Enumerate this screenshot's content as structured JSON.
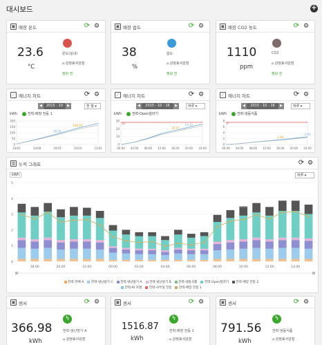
{
  "app": {
    "title": "대시보드"
  },
  "sensors": [
    {
      "title": "매장 온도",
      "value": "23.6",
      "unit": "°C",
      "name": "온도(실내)",
      "location": "강정효서강점",
      "status": "정보 전",
      "icon": "thermometer-icon",
      "color": "#d9534f"
    },
    {
      "title": "매장 습도",
      "value": "38",
      "unit": "%",
      "name": "습도",
      "location": "강정효서강점",
      "status": "정보 전",
      "icon": "water-drop-icon",
      "color": "#3b9bd8"
    },
    {
      "title": "매장 CO2 농도",
      "value": "1110",
      "unit": "ppm",
      "name": "CO2",
      "location": "강정효서강점",
      "status": "정보 전",
      "icon": "gauge-icon",
      "color": "#7d6a6a"
    }
  ],
  "energy_charts": [
    {
      "title": "에너지 차트",
      "date": "2015 - 10",
      "mode": "전 월",
      "unit": "kWh",
      "legend": "전력-매장 전등 1",
      "chart_data": {
        "type": "line",
        "x": [
          "10/01",
          "10/08",
          "10/16",
          "10/24",
          "11/01"
        ],
        "ylim": [
          0,
          200
        ],
        "yticks": [
          0,
          50,
          100,
          150,
          200
        ],
        "series": [
          {
            "name": "전력-매장 전등 1",
            "values": [
              5,
              45,
              90,
              140,
              180
            ]
          }
        ],
        "annotations": [
          {
            "label": "95.16",
            "x": "10/16"
          },
          {
            "label": "180.76",
            "x": "10/24"
          }
        ]
      }
    },
    {
      "title": "에너지 차트",
      "date": "2015 - 10 - 16",
      "mode": "하루",
      "unit": "kWh",
      "legend": "전력-Open칠러기",
      "chart_data": {
        "type": "line",
        "x": [
          "00:00",
          "04:00",
          "08:00",
          "12:00",
          "16:00",
          "20:00",
          "24:00"
        ],
        "ylim": [
          0,
          30
        ],
        "yticks": [
          0,
          10,
          20,
          30
        ],
        "series": [
          {
            "name": "전력-Open칠러기",
            "values": [
              0,
              3,
              8,
              14,
              18,
              22,
              26
            ]
          }
        ],
        "annotations": [
          {
            "label": "30",
            "x": "00:00"
          },
          {
            "label": "18.72",
            "x": "16:00"
          },
          {
            "label": "15.35",
            "x": "20:00"
          }
        ]
      }
    },
    {
      "title": "에너지 차트",
      "date": "2015 - 10 - 16",
      "mode": "하루",
      "unit": "kWh",
      "legend": "전력-냉동식품",
      "chart_data": {
        "type": "line",
        "x": [
          "00:00",
          "04:00",
          "08:00",
          "12:00",
          "16:00",
          "20:00",
          "24:00"
        ],
        "ylim": [
          0,
          8
        ],
        "yticks": [
          0,
          2,
          4,
          6,
          8
        ],
        "series": [
          {
            "name": "전력-냉동식품",
            "values": [
              0,
              0.3,
              0.8,
              1.2,
              1.6,
              2.1,
              2.6
            ]
          }
        ],
        "annotations": [
          {
            "label": "6",
            "x": "00:00"
          },
          {
            "label": "1.99",
            "x": "16:00"
          },
          {
            "label": "3.93",
            "x": "24:00"
          }
        ]
      }
    }
  ],
  "stack": {
    "title": "누적 그래프",
    "unit": "kWh",
    "mode": "하루",
    "chart_data": {
      "type": "bar",
      "ylim": [
        0,
        5
      ],
      "yticks": [
        0,
        1,
        2,
        3,
        4,
        5
      ],
      "xticks": [
        "18:00",
        "20:00",
        "22:00",
        "00:00",
        "02:00",
        "04:00",
        "06:00",
        "08:00",
        "10:00",
        "12:00",
        "14:00"
      ],
      "categories": [
        "17:00",
        "18:00",
        "19:00",
        "20:00",
        "21:00",
        "22:00",
        "23:00",
        "00:00",
        "01:00",
        "02:00",
        "03:00",
        "04:00",
        "05:00",
        "06:00",
        "07:00",
        "08:00",
        "09:00",
        "10:00",
        "11:00",
        "12:00",
        "13:00",
        "14:00",
        "15:00"
      ],
      "totals": [
        3.65,
        3.45,
        3.7,
        3.3,
        3.45,
        3.4,
        3.2,
        2.3,
        2.0,
        1.85,
        1.85,
        1.6,
        2.0,
        1.75,
        1.85,
        2.95,
        3.25,
        3.5,
        3.7,
        3.45,
        3.85,
        3.85,
        3.6
      ],
      "line": [
        2.95,
        2.7,
        3.1,
        2.5,
        2.6,
        2.65,
        2.3,
        1.55,
        1.3,
        1.2,
        1.25,
        0.95,
        1.15,
        1.05,
        1.2,
        2.2,
        2.55,
        2.65,
        2.95,
        2.7,
        3.1,
        3.15,
        2.85
      ],
      "series": [
        {
          "name": "전력-전체 A",
          "color": "#f3c18d",
          "values": [
            0.15,
            0.15,
            0.15,
            0.15,
            0.15,
            0.15,
            0.15,
            0.1,
            0.1,
            0.1,
            0.1,
            0.1,
            0.1,
            0.1,
            0.1,
            0.15,
            0.15,
            0.15,
            0.15,
            0.15,
            0.15,
            0.15,
            0.15
          ]
        },
        {
          "name": "전력-냉난방기 C",
          "color": "#9ccbec",
          "values": [
            0.7,
            0.65,
            0.7,
            0.6,
            0.65,
            0.65,
            0.6,
            0.45,
            0.4,
            0.35,
            0.35,
            0.3,
            0.4,
            0.35,
            0.35,
            0.55,
            0.6,
            0.65,
            0.7,
            0.65,
            0.7,
            0.7,
            0.65
          ]
        },
        {
          "name": "전력-냉난방기 A",
          "color": "#8e8fd0",
          "values": [
            0.5,
            0.45,
            0.5,
            0.45,
            0.45,
            0.45,
            0.45,
            0.3,
            0.25,
            0.25,
            0.25,
            0.2,
            0.25,
            0.25,
            0.25,
            0.4,
            0.45,
            0.45,
            0.5,
            0.45,
            0.5,
            0.5,
            0.5
          ]
        },
        {
          "name": "전력-냉난방기 B",
          "color": "#e7b3d6",
          "values": [
            0.15,
            0.15,
            0.15,
            0.15,
            0.15,
            0.15,
            0.15,
            0.1,
            0.1,
            0.1,
            0.1,
            0.1,
            0.1,
            0.1,
            0.1,
            0.15,
            0.15,
            0.15,
            0.15,
            0.15,
            0.15,
            0.15,
            0.15
          ]
        },
        {
          "name": "전력-Open칠러기",
          "color": "#6fcfc4",
          "values": [
            1.6,
            1.5,
            1.65,
            1.45,
            1.5,
            1.5,
            1.4,
            1.0,
            0.85,
            0.8,
            0.8,
            0.65,
            0.85,
            0.7,
            0.8,
            1.25,
            1.4,
            1.5,
            1.6,
            1.5,
            1.7,
            1.7,
            1.55
          ]
        },
        {
          "name": "전력-매장 전등 2",
          "color": "#555555",
          "values": [
            0.55,
            0.55,
            0.55,
            0.5,
            0.55,
            0.5,
            0.45,
            0.35,
            0.3,
            0.25,
            0.25,
            0.25,
            0.3,
            0.25,
            0.25,
            0.45,
            0.5,
            0.55,
            0.6,
            0.55,
            0.65,
            0.65,
            0.6
          ]
        }
      ]
    },
    "legend": [
      "전력-전체 A",
      "전력-냉난방기 C",
      "전력-냉난방기 A",
      "전력-냉난방기 B",
      "전력-냉동식품",
      "전력-Open칠러기",
      "전력-매장 전등 2",
      "전력-RI 조명",
      "전력-사무실 전등",
      "전력-매장 전등 1"
    ],
    "legend_colors": [
      "#f0a860",
      "#9ccbec",
      "#8e8fd0",
      "#e7b3d6",
      "#7fbf7f",
      "#6fcfc4",
      "#555555",
      "#86c3e9",
      "#d96b6b",
      "#c9a96b"
    ]
  },
  "bottom": [
    {
      "title": "센서",
      "value": "366.98",
      "unit": "kWh",
      "name": "전력-냉난방기 A",
      "location": "강정효서강점"
    },
    {
      "title": "센서",
      "value": "1516.87",
      "unit": "kWh",
      "name": "전력-매장 전등 1",
      "location": "강정효서강점"
    },
    {
      "title": "센서",
      "value": "791.56",
      "unit": "kWh",
      "name": "전력-냉동식품",
      "location": "강정효서강점"
    }
  ]
}
